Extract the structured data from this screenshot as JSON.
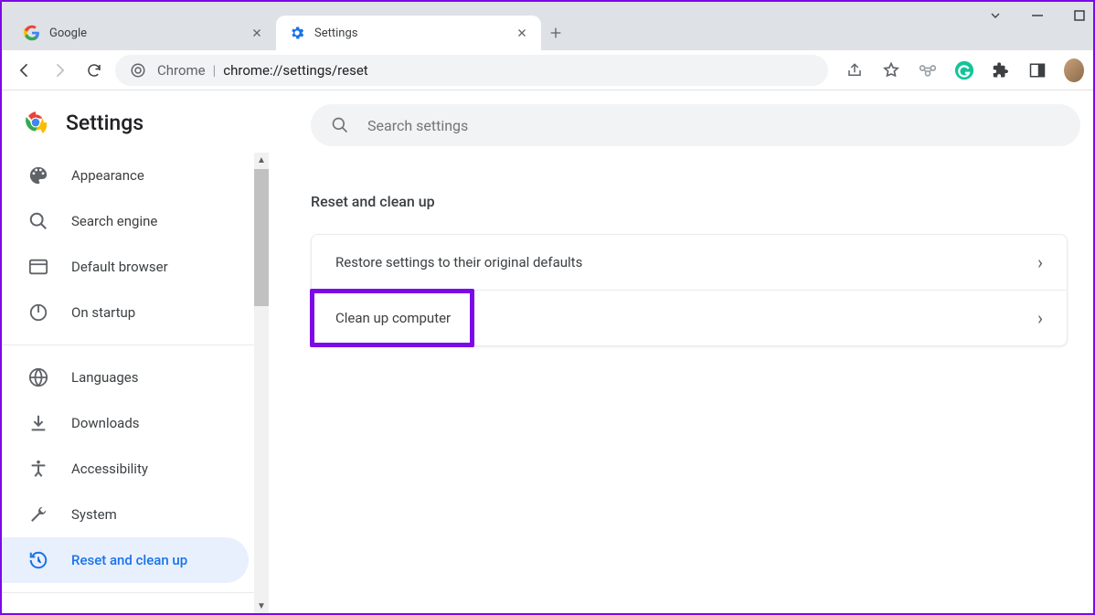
{
  "tabs": [
    {
      "title": "Google"
    },
    {
      "title": "Settings"
    }
  ],
  "address": {
    "scheme": "Chrome",
    "path": "chrome://settings/reset"
  },
  "settings_title": "Settings",
  "search": {
    "placeholder": "Search settings"
  },
  "sidebar": {
    "items_top": [
      {
        "label": "Appearance"
      },
      {
        "label": "Search engine"
      },
      {
        "label": "Default browser"
      },
      {
        "label": "On startup"
      }
    ],
    "items_bottom": [
      {
        "label": "Languages"
      },
      {
        "label": "Downloads"
      },
      {
        "label": "Accessibility"
      },
      {
        "label": "System"
      },
      {
        "label": "Reset and clean up"
      }
    ]
  },
  "section": {
    "title": "Reset and clean up",
    "rows": [
      {
        "label": "Restore settings to their original defaults"
      },
      {
        "label": "Clean up computer"
      }
    ]
  }
}
